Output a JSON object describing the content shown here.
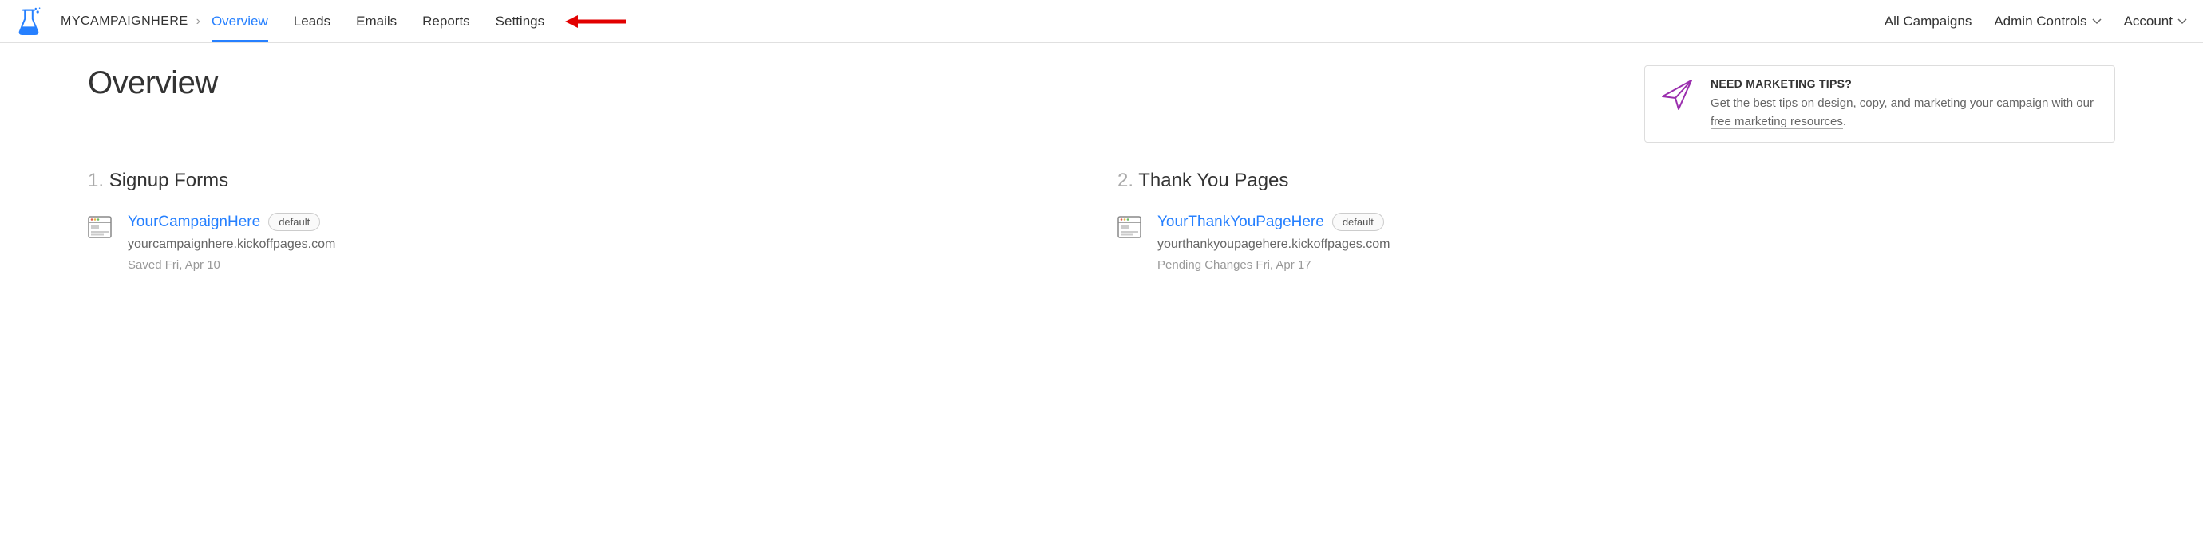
{
  "nav": {
    "campaign_name": "MYCAMPAIGNHERE",
    "breadcrumb_sep": "›",
    "tabs": [
      "Overview",
      "Leads",
      "Emails",
      "Reports",
      "Settings"
    ],
    "active_tab": "Overview",
    "right": {
      "all_campaigns": "All Campaigns",
      "admin_controls": "Admin Controls",
      "account": "Account"
    }
  },
  "page_title": "Overview",
  "tip": {
    "title": "NEED MARKETING TIPS?",
    "body_prefix": "Get the best tips on design, copy, and marketing your campaign with our ",
    "link_text": "free marketing resources",
    "body_suffix": "."
  },
  "sections": {
    "signup": {
      "num": "1.",
      "label": "Signup Forms",
      "item": {
        "name": "YourCampaignHere",
        "badge": "default",
        "url": "yourcampaignhere.kickoffpages.com",
        "saved": "Saved Fri, Apr 10"
      }
    },
    "thankyou": {
      "num": "2.",
      "label": "Thank You Pages",
      "item": {
        "name": "YourThankYouPageHere",
        "badge": "default",
        "url": "yourthankyoupagehere.kickoffpages.com",
        "saved": "Pending Changes Fri, Apr 17"
      }
    }
  }
}
